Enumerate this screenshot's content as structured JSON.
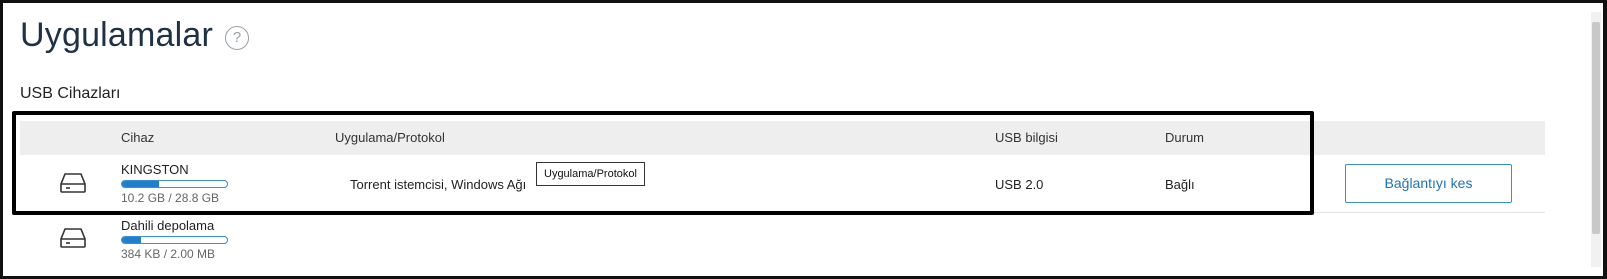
{
  "page": {
    "title": "Uygulamalar",
    "help_glyph": "?"
  },
  "section": {
    "title": "USB Cihazları"
  },
  "table": {
    "columns": {
      "device": "Cihaz",
      "app_protocol": "Uygulama/Protokol",
      "usb_info": "USB bilgisi",
      "status": "Durum"
    },
    "rows": [
      {
        "icon": "hard-drive-icon",
        "name": "KINGSTON",
        "usage_fraction": 0.35,
        "size": "10.2 GB / 28.8 GB",
        "app_protocol": "Torrent istemcisi, Windows Ağı",
        "usb_info": "USB 2.0",
        "status": "Bağlı",
        "action_label": "Bağlantıyı kes"
      },
      {
        "icon": "hard-drive-icon",
        "name": "Dahili depolama",
        "usage_fraction": 0.18,
        "size": "384 KB / 2.00 MB"
      }
    ]
  },
  "tooltip": {
    "text": "Uygulama/Protokol"
  },
  "colors": {
    "title": "#1f3047",
    "accent": "#1e7fcf",
    "button_text": "#1f73b7",
    "header_bg": "#eeeeee"
  }
}
